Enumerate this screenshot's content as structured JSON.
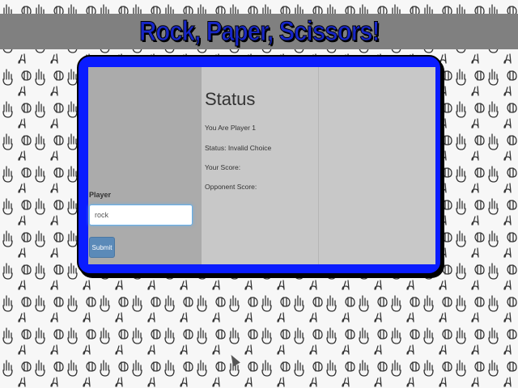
{
  "header": {
    "title": "Rock, Paper, Scissors!"
  },
  "form": {
    "player_label": "Player",
    "player_value": "rock",
    "submit_label": "Submit"
  },
  "status": {
    "heading": "Status",
    "player_line": "You Are Player 1",
    "status_line": "Status: Invalid Choice",
    "your_score_line": "Your Score:",
    "opponent_score_line": "Opponent Score:"
  },
  "colors": {
    "title_text": "#1726c7",
    "title_bar": "#808080",
    "frame": "#0a1cff",
    "button": "#5b8ab8"
  }
}
